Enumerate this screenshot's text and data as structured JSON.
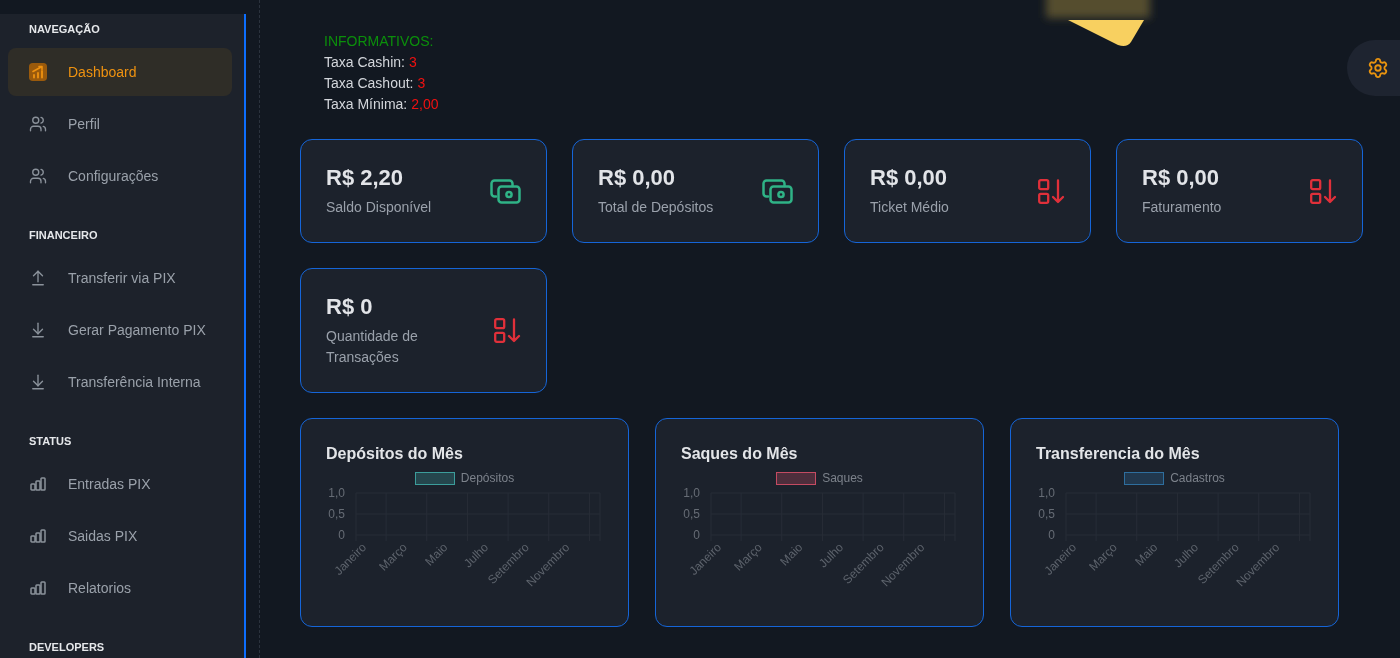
{
  "sidebar": {
    "sections": [
      {
        "title": "NAVEGAÇÃO",
        "items": [
          {
            "label": "Dashboard",
            "selected": true
          },
          {
            "label": "Perfil",
            "selected": false
          },
          {
            "label": "Configurações",
            "selected": false
          }
        ]
      },
      {
        "title": "FINANCEIRO",
        "items": [
          {
            "label": "Transferir via PIX",
            "selected": false
          },
          {
            "label": "Gerar Pagamento PIX",
            "selected": false
          },
          {
            "label": "Transferência Interna",
            "selected": false
          }
        ]
      },
      {
        "title": "STATUS",
        "items": [
          {
            "label": "Entradas PIX",
            "selected": false
          },
          {
            "label": "Saidas PIX",
            "selected": false
          },
          {
            "label": "Relatorios",
            "selected": false
          }
        ]
      },
      {
        "title": "DEVELOPERS"
      }
    ]
  },
  "informativos": {
    "heading": "INFORMATIVOS:",
    "rates": [
      {
        "label": "Taxa Cashin:",
        "value": "3"
      },
      {
        "label": "Taxa Cashout:",
        "value": "3"
      },
      {
        "label": "Taxa Mínima:",
        "value": "2,00"
      }
    ]
  },
  "stat_cards": [
    {
      "value": "R$ 2,20",
      "label": "Saldo Disponível",
      "kind": "balance"
    },
    {
      "value": "R$ 0,00",
      "label": "Total de Depósitos",
      "kind": "balance"
    },
    {
      "value": "R$ 0,00",
      "label": "Ticket Médio",
      "kind": "metric"
    },
    {
      "value": "R$ 0,00",
      "label": "Faturamento",
      "kind": "metric"
    },
    {
      "value": "R$ 0",
      "label": "Quantidade de Transações",
      "kind": "metric"
    }
  ],
  "charts": [
    {
      "chart_data": {
        "type": "bar",
        "title": "Depósitos do Mês",
        "categories": [
          "Janeiro",
          "Março",
          "Maio",
          "Julho",
          "Setembro",
          "Novembro"
        ],
        "series": [
          {
            "name": "Depósitos",
            "color": "#3c9d9b",
            "values": [
              null,
              null,
              null,
              null,
              null,
              null
            ]
          }
        ],
        "ylim": [
          0,
          1
        ],
        "yticks": [
          {
            "value": 0,
            "label": "0"
          },
          {
            "value": 0.5,
            "label": "0,5"
          },
          {
            "value": 1,
            "label": "1,0"
          }
        ]
      }
    },
    {
      "chart_data": {
        "type": "bar",
        "title": "Saques do Mês",
        "categories": [
          "Janeiro",
          "Março",
          "Maio",
          "Julho",
          "Setembro",
          "Novembro"
        ],
        "series": [
          {
            "name": "Saques",
            "color": "#c44b62",
            "values": [
              null,
              null,
              null,
              null,
              null,
              null
            ]
          }
        ],
        "ylim": [
          0,
          1
        ],
        "yticks": [
          {
            "value": 0,
            "label": "0"
          },
          {
            "value": 0.5,
            "label": "0,5"
          },
          {
            "value": 1,
            "label": "1,0"
          }
        ]
      }
    },
    {
      "chart_data": {
        "type": "bar",
        "title": "Transferencia do Mês",
        "categories": [
          "Janeiro",
          "Março",
          "Maio",
          "Julho",
          "Setembro",
          "Novembro"
        ],
        "series": [
          {
            "name": "Cadastros",
            "color": "#2e6e9e",
            "values": [
              null,
              null,
              null,
              null,
              null,
              null
            ]
          }
        ],
        "ylim": [
          0,
          1
        ],
        "yticks": [
          {
            "value": 0,
            "label": "0"
          },
          {
            "value": 0.5,
            "label": "0,5"
          },
          {
            "value": 1,
            "label": "1,0"
          }
        ]
      }
    }
  ]
}
